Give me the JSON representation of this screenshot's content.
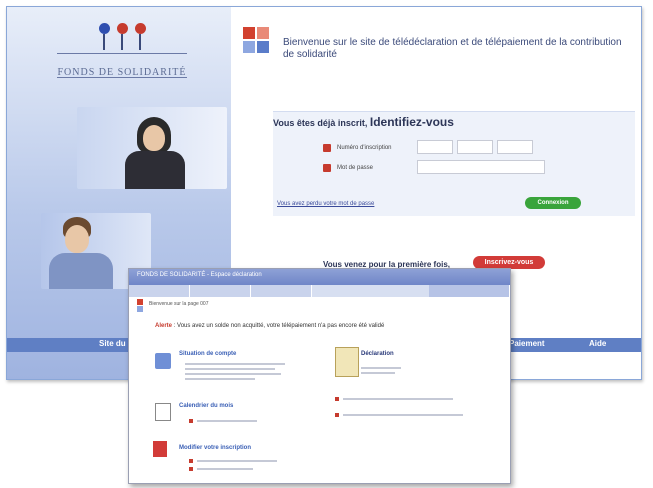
{
  "logo": {
    "name": "FONDS DE SOLIDARITÉ",
    "ring_colors": [
      "#2f4fb0",
      "#c63b2e",
      "#c63b2e"
    ]
  },
  "welcome": "Bienvenue sur le site de télédéclaration et de télépaiement de la contribution de solidarité",
  "login": {
    "title_prefix": "Vous êtes déjà inscrit,",
    "title_main": "Identifiez-vous",
    "field_id_label": "Numéro d'inscription",
    "field_password_label": "Mot de passe",
    "forgot_link": "Vous avez perdu votre mot de passe",
    "connect_button": "Connexion"
  },
  "register": {
    "text": "Vous venez pour la première fois,",
    "button": "Inscrivez-vous"
  },
  "footer": {
    "left": "Site du",
    "middle": "Paiement",
    "right": "Aide"
  },
  "front": {
    "topbar_title": "FONDS DE SOLIDARITÉ - Espace déclaration",
    "subheader": "Bienvenue sur la page 007",
    "alert_label": "Alerte",
    "alert_text": ": Vous avez un solde non acquitté, votre télépaiement n'a pas encore été validé",
    "section_account": "Situation de compte",
    "section_calendar": "Calendrier du mois",
    "section_declaration": "Déclaration",
    "section_modify": "Modifier votre inscription"
  },
  "colors": {
    "accent_red": "#d23b38",
    "accent_green": "#39a43b",
    "nav_blue": "#5f7fc4"
  }
}
